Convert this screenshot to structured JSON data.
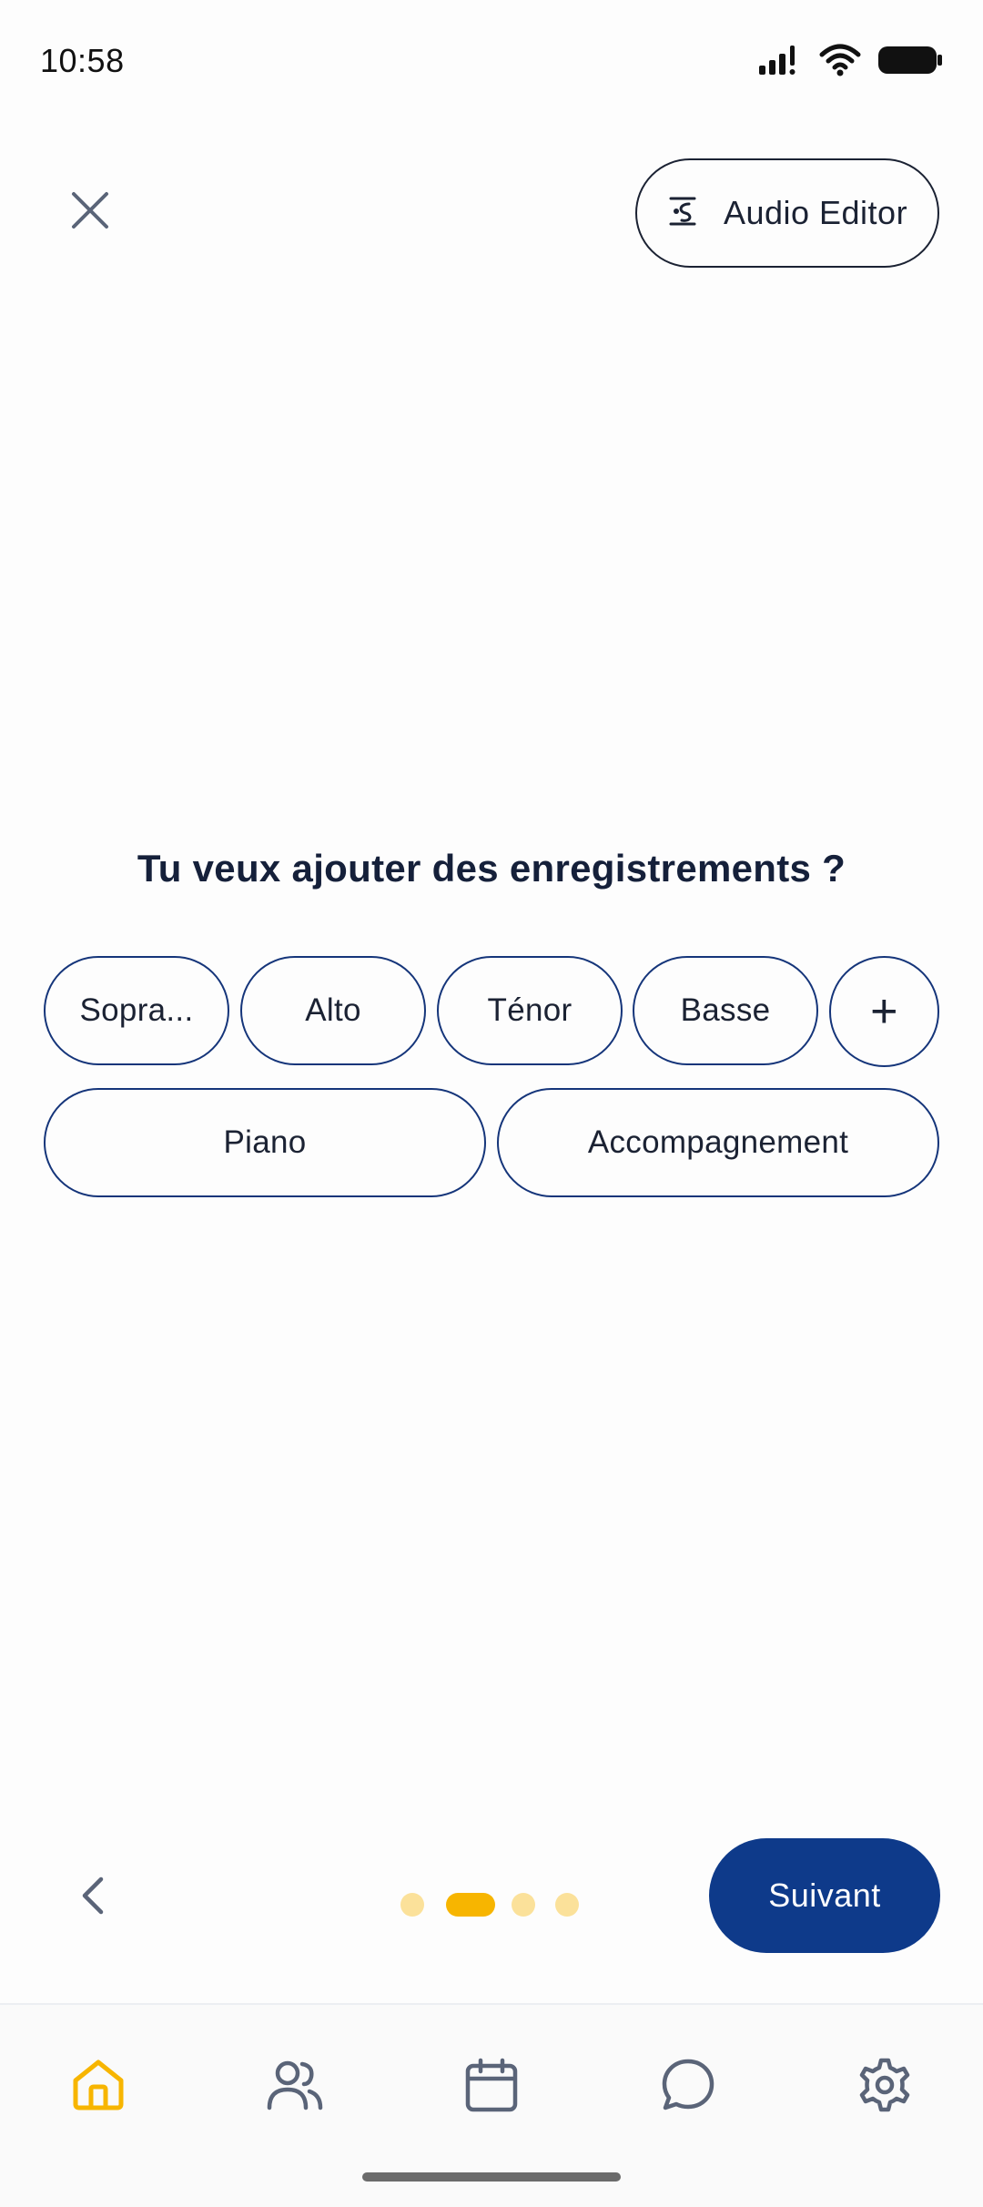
{
  "status_bar": {
    "time": "10:58"
  },
  "header": {
    "audio_editor_label": "Audio Editor"
  },
  "main": {
    "question": "Tu veux ajouter des enregistrements ?",
    "chips": [
      {
        "label": "Sopra..."
      },
      {
        "label": "Alto"
      },
      {
        "label": "Ténor"
      },
      {
        "label": "Basse"
      },
      {
        "label": "+"
      },
      {
        "label": "Piano"
      },
      {
        "label": "Accompagnement"
      }
    ]
  },
  "footer": {
    "next_label": "Suivant",
    "page_indicator": {
      "total": 4,
      "current": 2
    }
  },
  "tabbar": {
    "tabs": [
      {
        "icon": "home-icon",
        "active": true
      },
      {
        "icon": "people-icon",
        "active": false
      },
      {
        "icon": "calendar-icon",
        "active": false
      },
      {
        "icon": "chat-icon",
        "active": false
      },
      {
        "icon": "gear-icon",
        "active": false
      }
    ]
  },
  "colors": {
    "primary": "#0e3a8a",
    "accent": "#f7b500",
    "accent_light": "#fbe19a",
    "chip_border": "#15357a",
    "icon_gray": "#5a6478"
  }
}
